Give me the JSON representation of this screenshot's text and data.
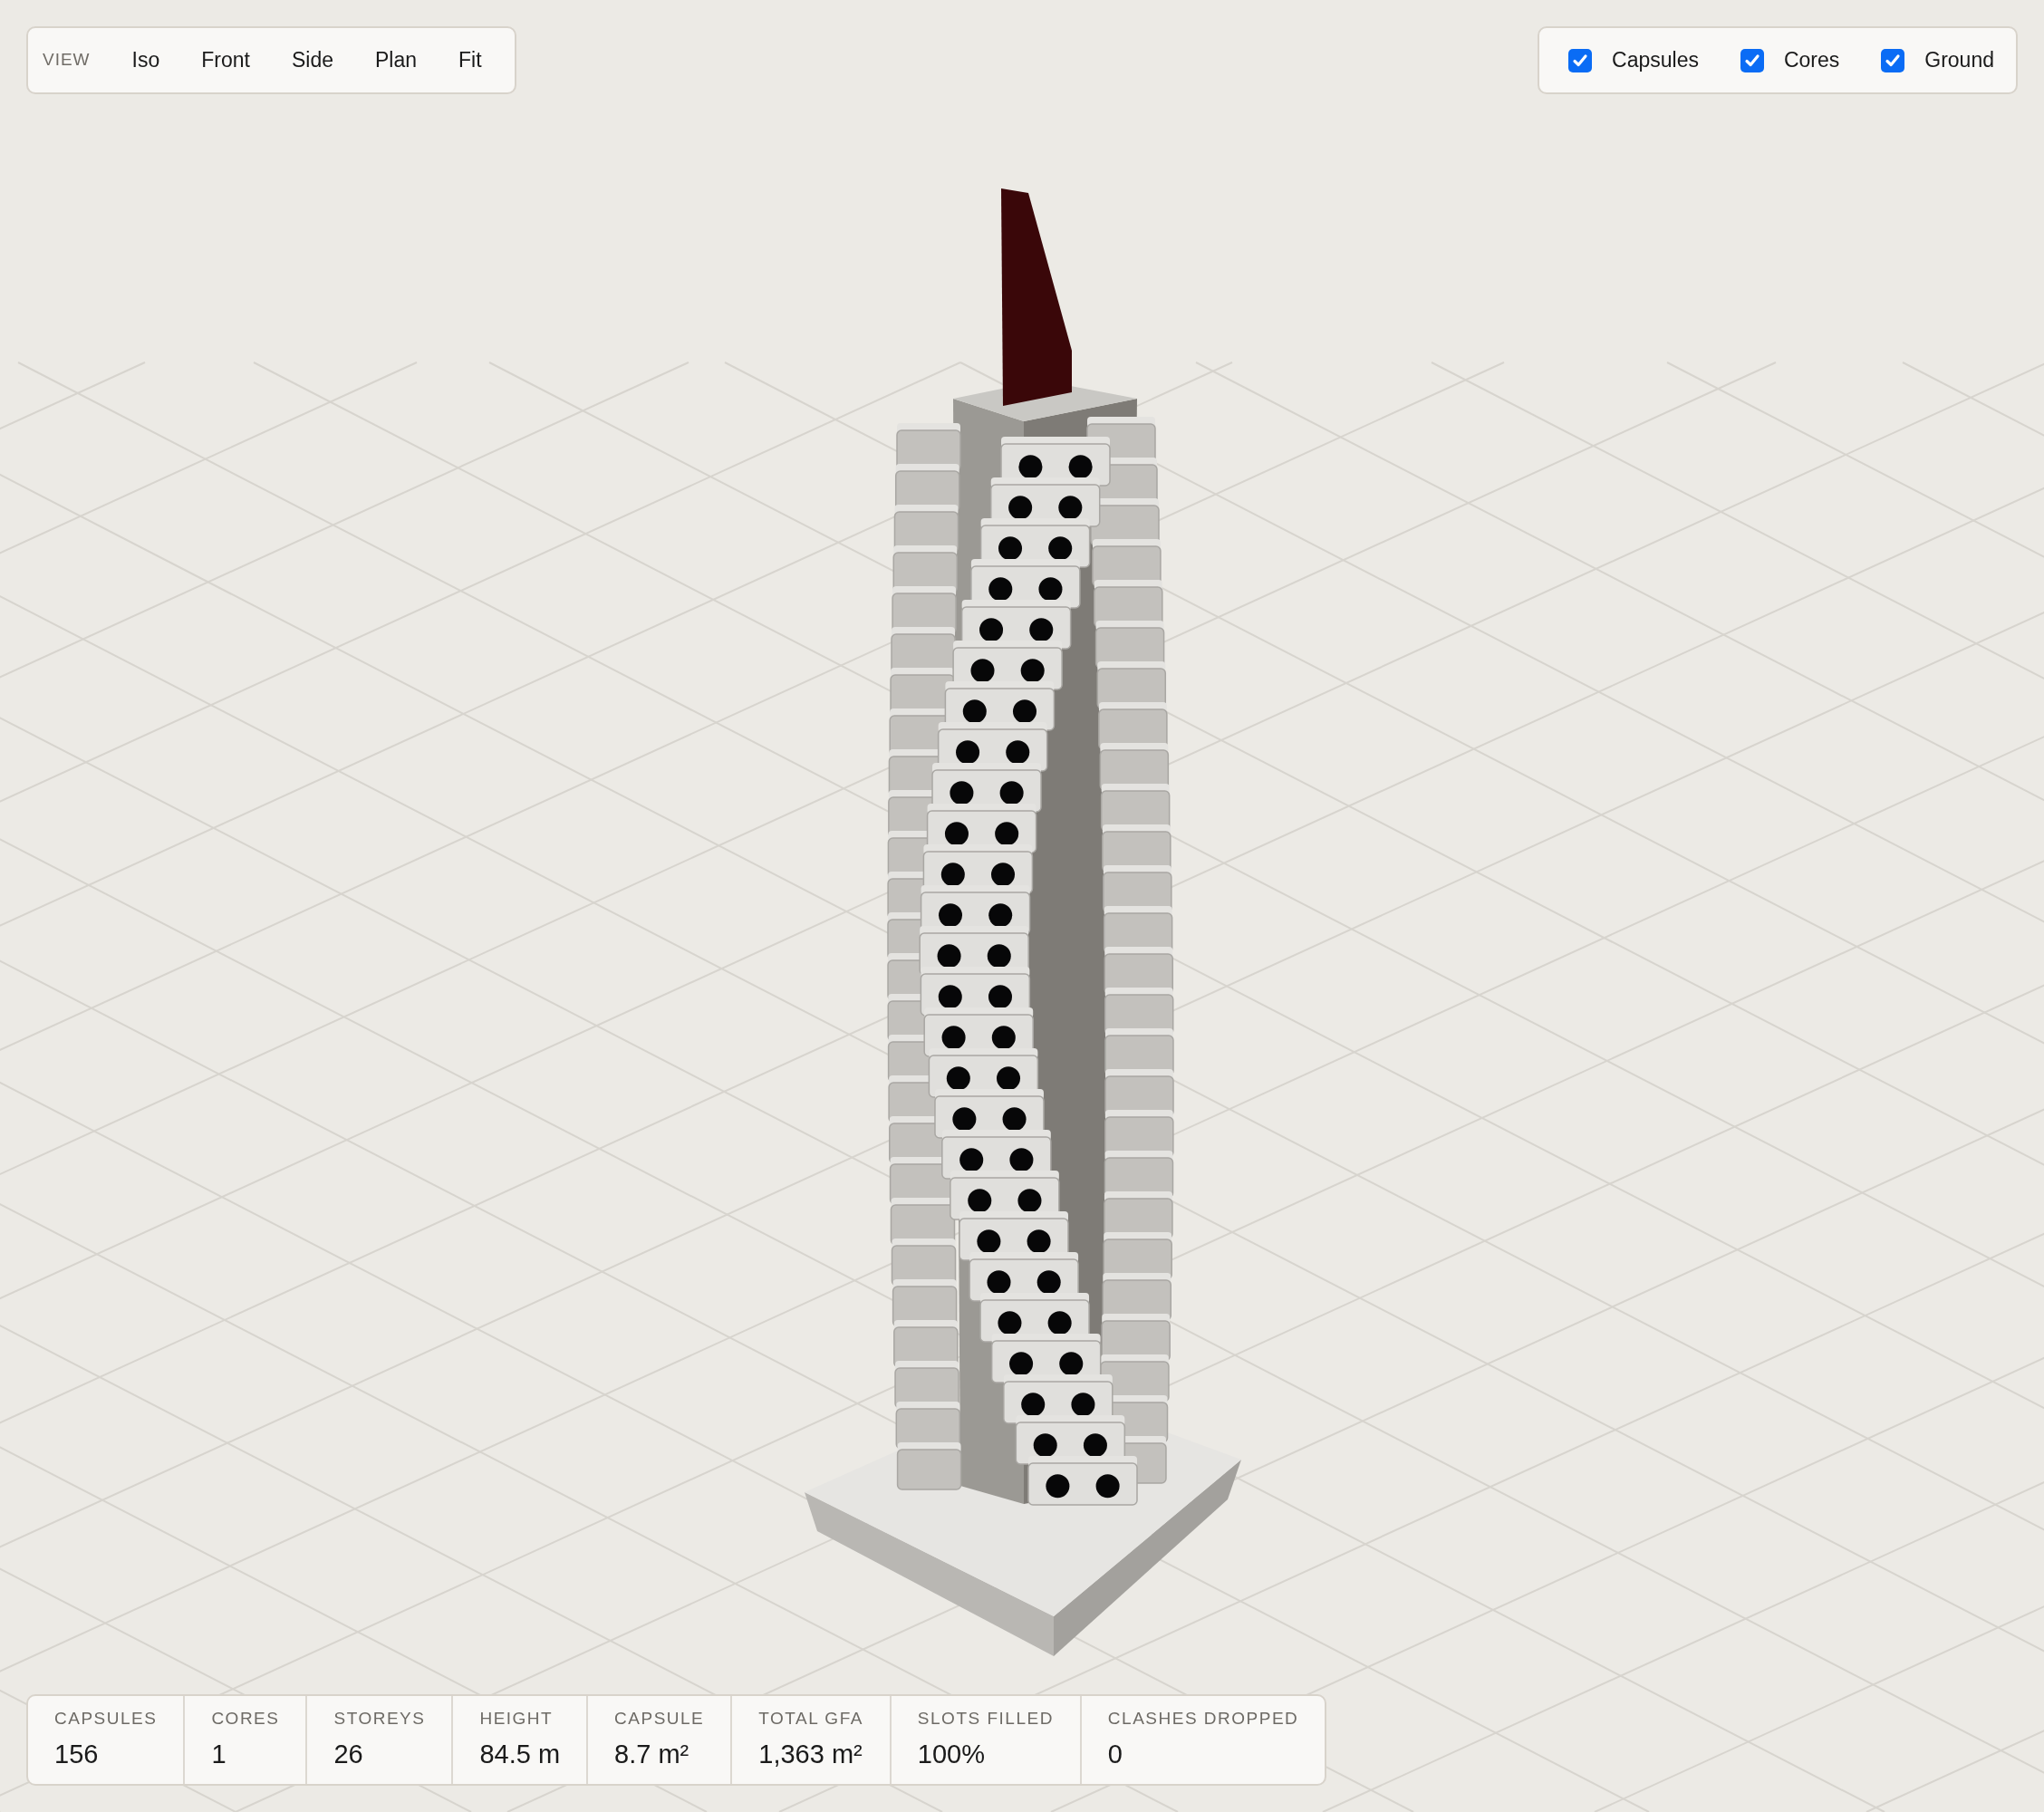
{
  "view_toolbar": {
    "label": "VIEW",
    "buttons": [
      "Iso",
      "Front",
      "Side",
      "Plan",
      "Fit"
    ]
  },
  "layers": [
    {
      "label": "Capsules",
      "checked": true
    },
    {
      "label": "Cores",
      "checked": true
    },
    {
      "label": "Ground",
      "checked": true
    }
  ],
  "stats": [
    {
      "label": "CAPSULES",
      "value": "156"
    },
    {
      "label": "CORES",
      "value": "1"
    },
    {
      "label": "STOREYS",
      "value": "26"
    },
    {
      "label": "HEIGHT",
      "value": "84.5 m"
    },
    {
      "label": "CAPSULE",
      "value": "8.7 m²"
    },
    {
      "label": "TOTAL GFA",
      "value": "1,363 m²"
    },
    {
      "label": "SLOTS FILLED",
      "value": "100%"
    },
    {
      "label": "CLASHES DROPPED",
      "value": "0"
    }
  ]
}
